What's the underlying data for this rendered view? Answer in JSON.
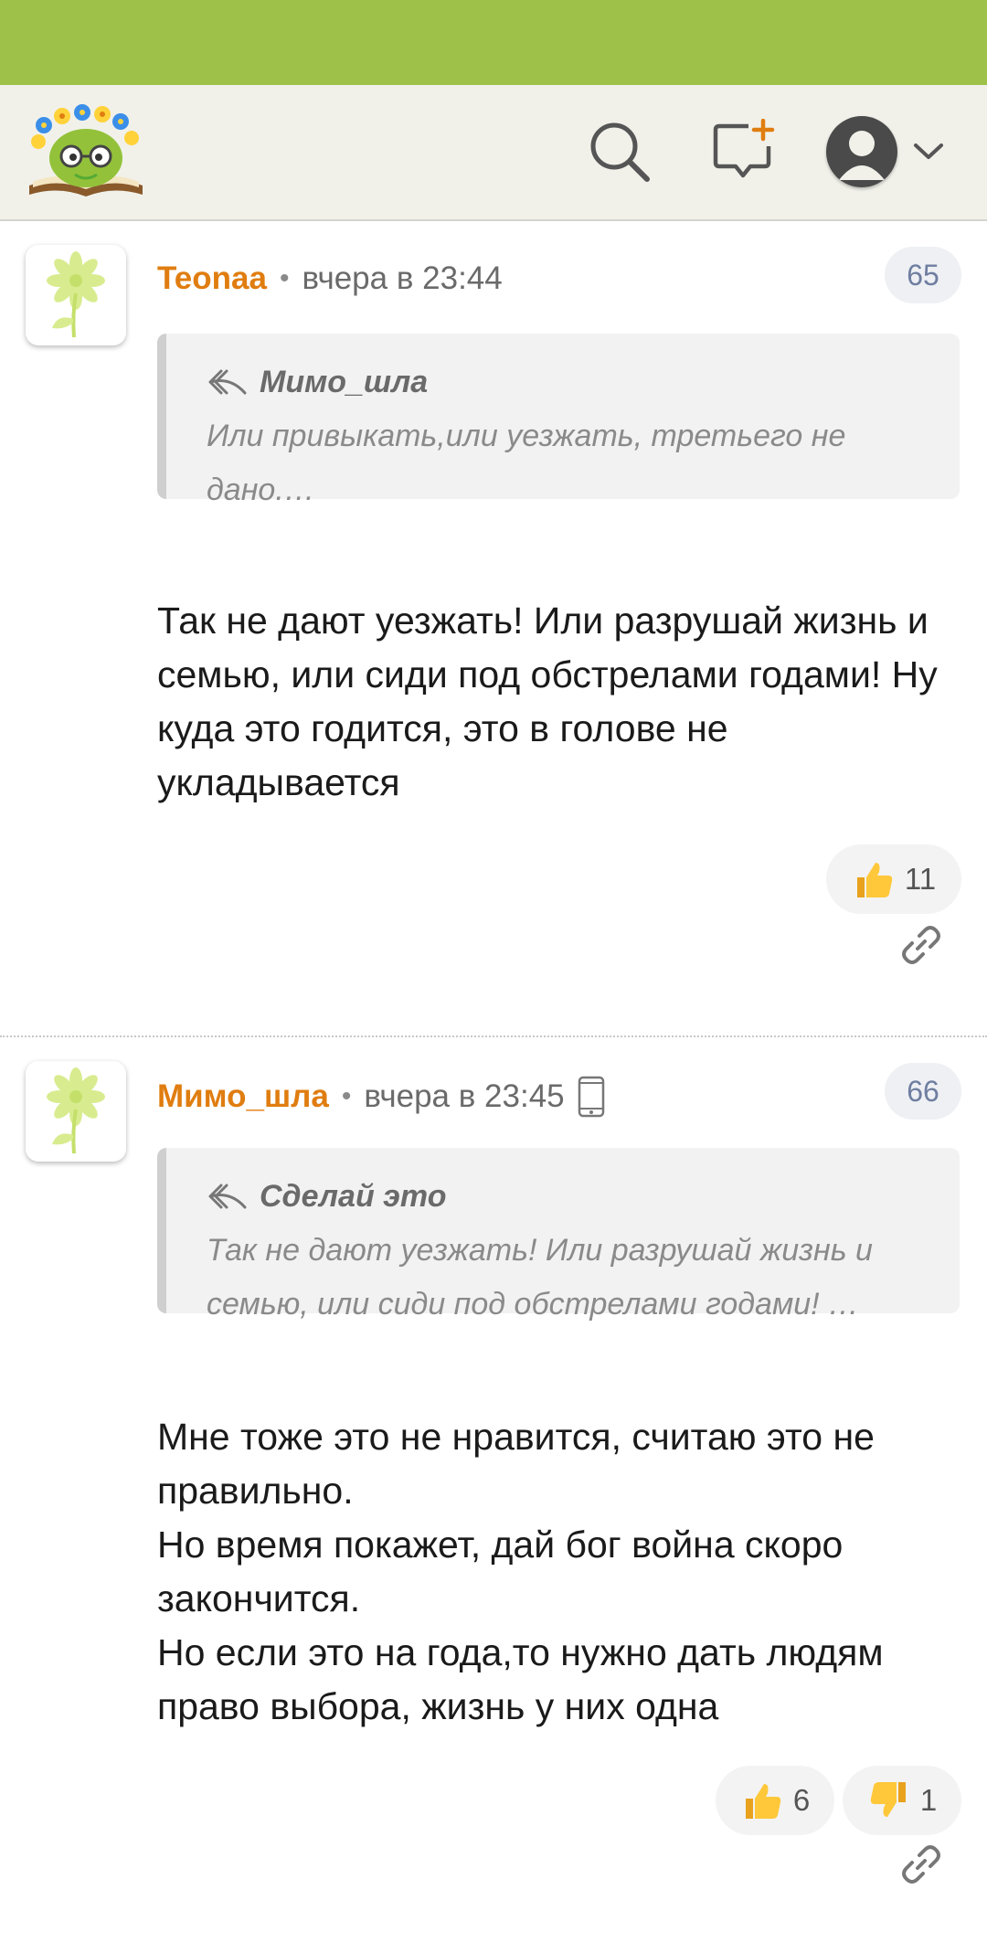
{
  "header": {
    "logo_icon": "smiley-book-logo-icon",
    "search_icon": "search-icon",
    "new_message_icon": "new-message-icon",
    "account_icon": "user-avatar-icon",
    "accent_color": "#9ec249",
    "author_color": "#e07d10"
  },
  "comments": [
    {
      "author": "Teonaa",
      "time": "вчера в 23:44",
      "number": "65",
      "quote_author": "Мимо_шла",
      "quote_text": "Или привыкать,или уезжать, третьего не дано.…",
      "body": "Так не дают уезжать! Или разрушай жизнь и семью, или сиди под обстрелами годами! Ну куда это годится, это в голове не укладывается",
      "likes": "11"
    },
    {
      "author": "Мимо_шла",
      "time": "вчера в 23:45",
      "number": "66",
      "quote_author": "Сделай это",
      "quote_text": "Так не дают уезжать! Или разрушай жизнь и семью, или сиди под обстрелами годами! …",
      "body": "Мне тоже это не нравится, считаю это не правильно.\nНо время покажет, дай бог война скоро закончится.\nНо если это на года,то нужно дать людям право выбора, жизнь у них одна",
      "likes": "6",
      "dislikes": "1"
    }
  ]
}
